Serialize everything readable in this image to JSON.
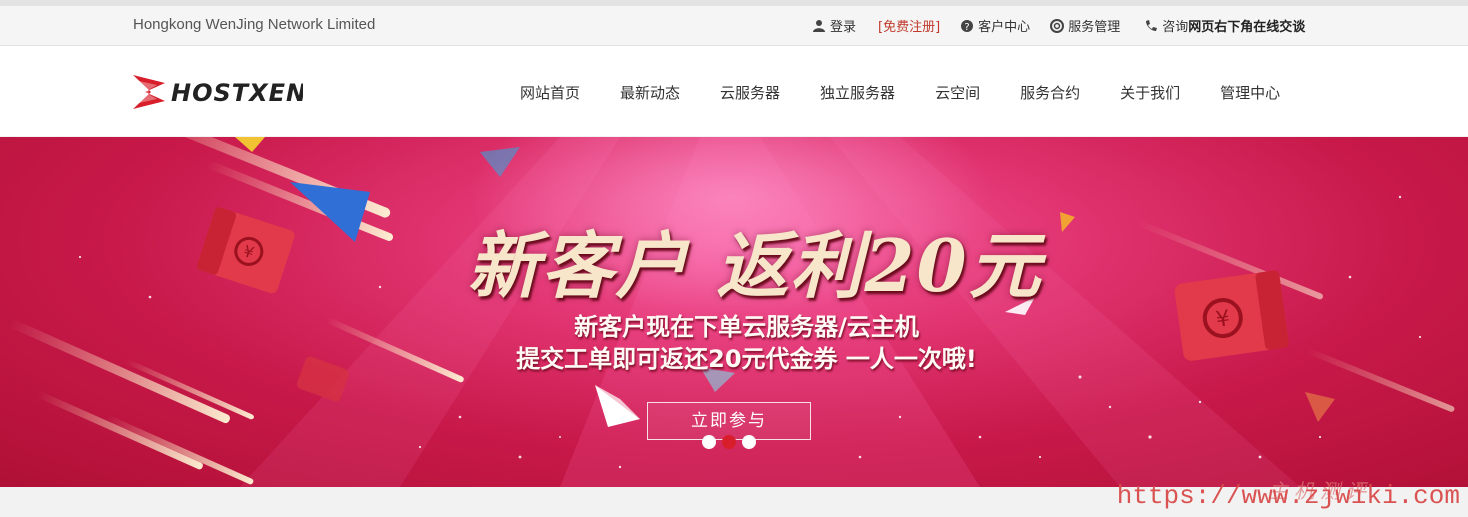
{
  "topbar": {
    "company": "Hongkong WenJing Network Limited",
    "login": "登录",
    "register": "[免费注册]",
    "client_center": "客户中心",
    "service_manage": "服务管理",
    "consult_prefix": "咨询",
    "consult_strong": "网页右下角在线交谈"
  },
  "header": {
    "logo_text": "HOSTXEN",
    "nav": [
      "网站首页",
      "最新动态",
      "云服务器",
      "独立服务器",
      "云空间",
      "服务合约",
      "关于我们",
      "管理中心"
    ]
  },
  "banner": {
    "headline": "新客户 返利20元",
    "line1": "新客户现在下单云服务器/云主机",
    "line2": "提交工单即可返还20元代金券 一人一次哦!",
    "cta": "立即参与",
    "slides_total": 3,
    "active_slide": 2
  },
  "watermark": {
    "url": "https://www.zjwiki.com",
    "cn": "主机测评"
  },
  "colors": {
    "accent": "#d81e2b",
    "register": "#c0392b",
    "banner": "#c8194a"
  }
}
